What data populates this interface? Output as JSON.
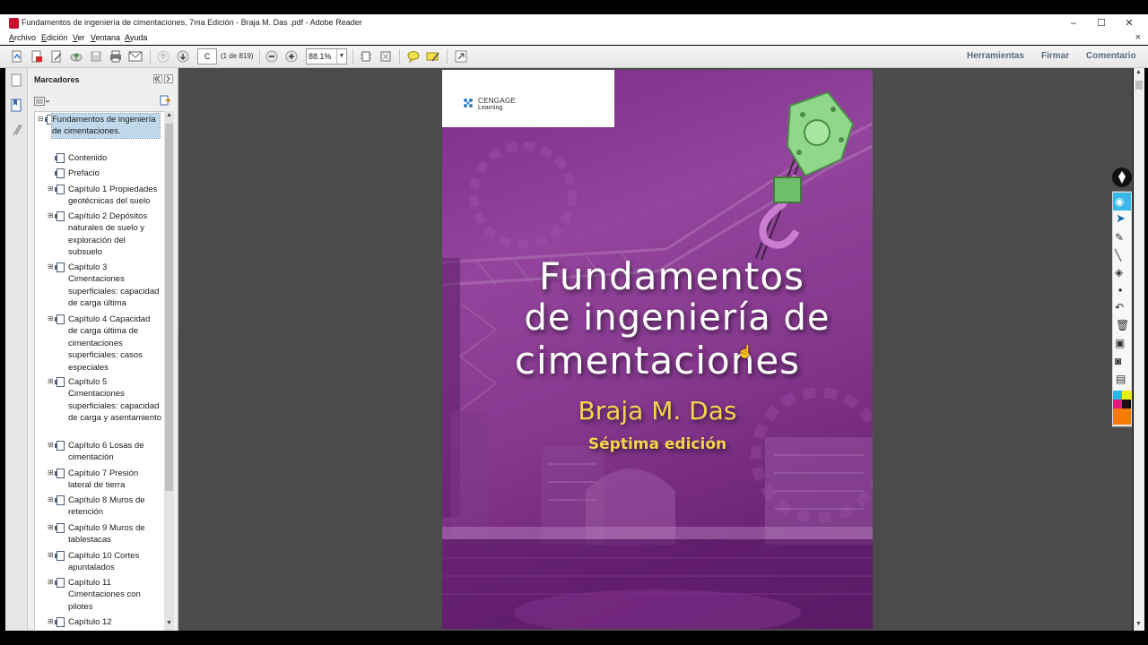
{
  "window": {
    "title": "Fundamentos de ingeniería de cimentaciones, 7ma Edición - Braja M. Das .pdf - Adobe Reader",
    "minimize": "–",
    "maximize": "☐",
    "close": "✕"
  },
  "menu": {
    "items": [
      "Archivo",
      "Edición",
      "Ver",
      "Ventana",
      "Ayuda"
    ],
    "close": "×"
  },
  "toolbar": {
    "page_value": "C",
    "page_count": "(1 de 819)",
    "zoom": "88.1%",
    "links": [
      "Herramientas",
      "Firmar",
      "Comentario"
    ]
  },
  "bookmarks": {
    "header": "Marcadores",
    "items": [
      {
        "label": "Fundamentos de ingeniería de cimentaciones.",
        "expander": "⊟",
        "selected": true
      },
      {
        "label": "Contenido",
        "expander": ""
      },
      {
        "label": "Prefacio",
        "expander": ""
      },
      {
        "label": "Capítulo 1 Propiedades geotécnicas del suelo",
        "expander": "⊞"
      },
      {
        "label": "Capítulo 2 Depósitos naturales de suelo y exploración del subsuelo",
        "expander": "⊞"
      },
      {
        "label": "Capítulo 3 Cimentaciones superficiales: capacidad de carga última",
        "expander": "⊞"
      },
      {
        "label": "Capítulo 4 Capacidad de carga última de cimentaciones superficiales: casos especiales",
        "expander": "⊞"
      },
      {
        "label": "Capítulo 5 Cimentaciones superficiales: capacidad de carga y asentamiento",
        "expander": "⊞"
      },
      {
        "label": "Capítulo 6 Losas de cimentación",
        "expander": "⊞"
      },
      {
        "label": "Capítulo 7 Presión lateral de tierra",
        "expander": "⊞"
      },
      {
        "label": "Capítulo 8 Muros de retención",
        "expander": "⊞"
      },
      {
        "label": "Capítulo 9 Muros de tablestacas",
        "expander": "⊞"
      },
      {
        "label": "Capítulo 10 Cortes apuntalados",
        "expander": "⊞"
      },
      {
        "label": "Capítulo 11 Cimentaciones con pilotes",
        "expander": "⊞"
      },
      {
        "label": "Capítulo 12",
        "expander": "⊞"
      }
    ]
  },
  "cover": {
    "publisher_line1": "CENGAGE",
    "publisher_line2": "Learning",
    "title_line1": "Fundamentos",
    "title_line2": "de ingeniería de",
    "title_line3": "cimentaciones",
    "author": "Braja M. Das",
    "edition": "Séptima edición",
    "colors": {
      "background": "#8a3a92",
      "accent": "#f2d64a",
      "hook": "#8fd88a"
    }
  },
  "right_tools": {
    "colors": [
      "#29b6e8",
      "#f5e81c",
      "#e6197f",
      "#111111",
      "#f57c00"
    ]
  }
}
